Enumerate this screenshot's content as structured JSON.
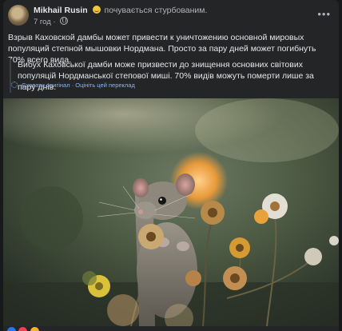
{
  "post": {
    "author": "Mikhail Rusin",
    "feeling": "почувається стурбованим.",
    "time": "7 год",
    "menu_glyph": "•••",
    "text": "Взрыв Каховской дамбы может привести к уничтожению основной мировых популяций степной мышовки Нордмана. Просто за пару дней может погибнуть 70% всего вида.",
    "translation": "Вибух Каховської дамби може призвести до знищення основних світових популяцій Нордманської степової миші. 70% видів можуть померти лише за пару днів.",
    "hide_original": "Сховати оригінал",
    "separator": "·",
    "rate_translation": "Оцініть цей переклад",
    "photo_alt": "Степная мышовка Нордмана среди цветов"
  },
  "icons": {
    "avatar": "avatar-photo",
    "feeling": "worried-face-emoji",
    "audience": "globe-icon",
    "menu": "more-options-icon",
    "translate": "translate-gear-icon"
  },
  "colors": {
    "background": "#18191a",
    "card": "#242526",
    "text": "#e4e6eb",
    "secondary": "#b0b3b8",
    "link": "#8ab4f8"
  }
}
